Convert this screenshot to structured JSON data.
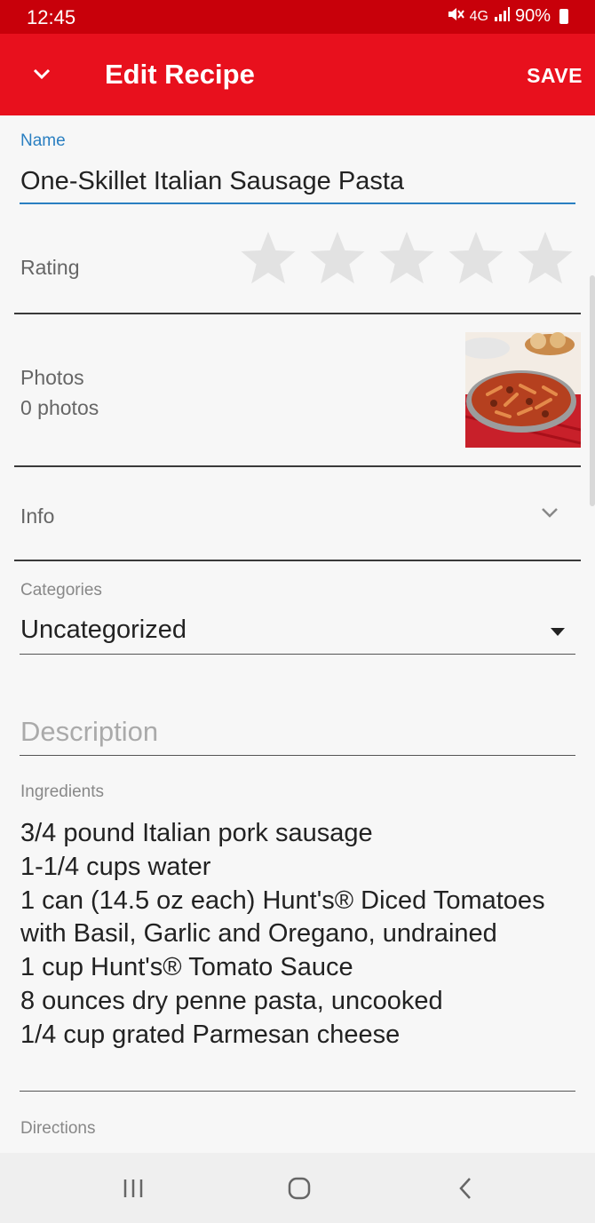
{
  "status": {
    "time": "12:45",
    "network": "4G",
    "battery": "90%"
  },
  "appbar": {
    "title": "Edit Recipe",
    "save_label": "SAVE"
  },
  "form": {
    "name_label": "Name",
    "name_value": "One-Skillet Italian Sausage Pasta",
    "rating_label": "Rating",
    "rating_value": 0,
    "rating_max": 5,
    "photos_label": "Photos",
    "photos_count": "0 photos",
    "info_label": "Info",
    "categories_label": "Categories",
    "categories_value": "Uncategorized",
    "description_placeholder": "Description",
    "ingredients_label": "Ingredients",
    "ingredients": [
      "3/4 pound Italian pork sausage",
      "1-1/4 cups water",
      "1 can (14.5 oz each) Hunt's® Diced Tomatoes with Basil, Garlic and Oregano, undrained",
      "1 cup Hunt's® Tomato Sauce",
      "8 ounces dry penne pasta, uncooked",
      "1/4 cup grated Parmesan cheese"
    ],
    "directions_label": "Directions"
  },
  "colors": {
    "status_bar": "#c8000a",
    "app_bar": "#e8101d",
    "accent": "#2a7fc1",
    "star_empty": "#e2e2e2"
  },
  "icons": {
    "collapse": "chevron-down-icon",
    "info": "chevron-down-icon",
    "categories": "dropdown-arrow-icon",
    "nav_recents": "recents-icon",
    "nav_home": "home-icon",
    "nav_back": "back-icon"
  }
}
